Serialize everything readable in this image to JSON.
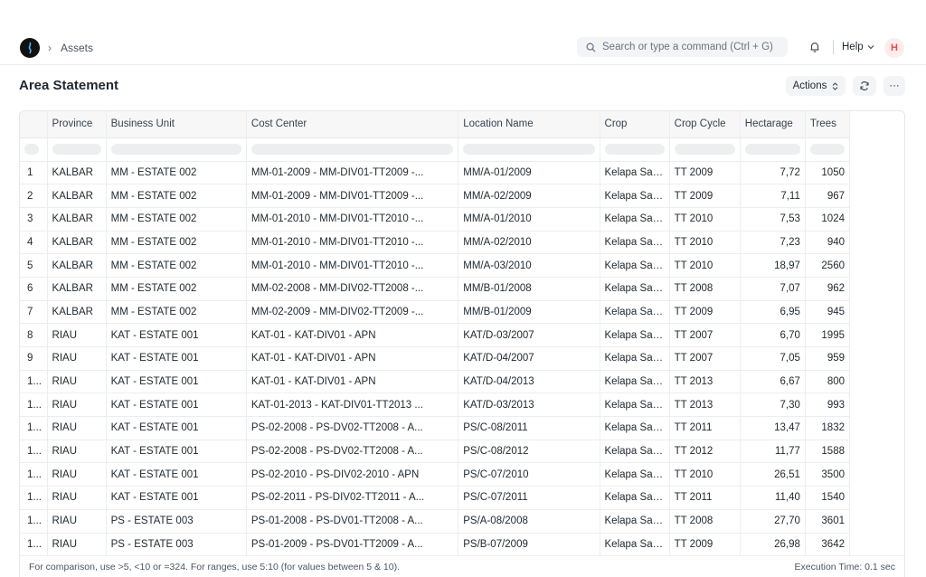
{
  "navbar": {
    "breadcrumb": "Assets",
    "search_placeholder": "Search or type a command (Ctrl + G)",
    "help_label": "Help",
    "avatar_initial": "H"
  },
  "page": {
    "title": "Area Statement",
    "actions_label": "Actions",
    "more_label": "···"
  },
  "table": {
    "columns": [
      "Province",
      "Business Unit",
      "Cost Center",
      "Location Name",
      "Crop",
      "Crop Cycle",
      "Hectarage",
      "Trees"
    ],
    "rows": [
      {
        "idx": "1",
        "province": "KALBAR",
        "bu": "MM - ESTATE 002",
        "cc": "MM-01-2009 - MM-DIV01-TT2009 -...",
        "loc": "MM/A-01/2009",
        "crop": "Kelapa Sawit",
        "cycle": "TT 2009",
        "ha": "7,72",
        "trees": "1050"
      },
      {
        "idx": "2",
        "province": "KALBAR",
        "bu": "MM - ESTATE 002",
        "cc": "MM-01-2009 - MM-DIV01-TT2009 -...",
        "loc": "MM/A-02/2009",
        "crop": "Kelapa Sawit",
        "cycle": "TT 2009",
        "ha": "7,11",
        "trees": "967"
      },
      {
        "idx": "3",
        "province": "KALBAR",
        "bu": "MM - ESTATE 002",
        "cc": "MM-01-2010 - MM-DIV01-TT2010 -...",
        "loc": "MM/A-01/2010",
        "crop": "Kelapa Sawit",
        "cycle": "TT 2010",
        "ha": "7,53",
        "trees": "1024"
      },
      {
        "idx": "4",
        "province": "KALBAR",
        "bu": "MM - ESTATE 002",
        "cc": "MM-01-2010 - MM-DIV01-TT2010 -...",
        "loc": "MM/A-02/2010",
        "crop": "Kelapa Sawit",
        "cycle": "TT 2010",
        "ha": "7,23",
        "trees": "940"
      },
      {
        "idx": "5",
        "province": "KALBAR",
        "bu": "MM - ESTATE 002",
        "cc": "MM-01-2010 - MM-DIV01-TT2010 -...",
        "loc": "MM/A-03/2010",
        "crop": "Kelapa Sawit",
        "cycle": "TT 2010",
        "ha": "18,97",
        "trees": "2560"
      },
      {
        "idx": "6",
        "province": "KALBAR",
        "bu": "MM - ESTATE 002",
        "cc": "MM-02-2008 - MM-DIV02-TT2008 -...",
        "loc": "MM/B-01/2008",
        "crop": "Kelapa Sawit",
        "cycle": "TT 2008",
        "ha": "7,07",
        "trees": "962"
      },
      {
        "idx": "7",
        "province": "KALBAR",
        "bu": "MM - ESTATE 002",
        "cc": "MM-02-2009 - MM-DIV02-TT2009 -...",
        "loc": "MM/B-01/2009",
        "crop": "Kelapa Sawit",
        "cycle": "TT 2009",
        "ha": "6,95",
        "trees": "945"
      },
      {
        "idx": "8",
        "province": "RIAU",
        "bu": "KAT - ESTATE 001",
        "cc": "KAT-01 - KAT-DIV01 - APN",
        "loc": "KAT/D-03/2007",
        "crop": "Kelapa Sawit",
        "cycle": "TT 2007",
        "ha": "6,70",
        "trees": "1995"
      },
      {
        "idx": "9",
        "province": "RIAU",
        "bu": "KAT - ESTATE 001",
        "cc": "KAT-01 - KAT-DIV01 - APN",
        "loc": "KAT/D-04/2007",
        "crop": "Kelapa Sawit",
        "cycle": "TT 2007",
        "ha": "7,05",
        "trees": "959"
      },
      {
        "idx": "1...",
        "province": "RIAU",
        "bu": "KAT - ESTATE 001",
        "cc": "KAT-01 - KAT-DIV01 - APN",
        "loc": "KAT/D-04/2013",
        "crop": "Kelapa Sawit",
        "cycle": "TT 2013",
        "ha": "6,67",
        "trees": "800"
      },
      {
        "idx": "1...",
        "province": "RIAU",
        "bu": "KAT - ESTATE 001",
        "cc": "KAT-01-2013 - KAT-DIV01-TT2013 ...",
        "loc": "KAT/D-03/2013",
        "crop": "Kelapa Sawit",
        "cycle": "TT 2013",
        "ha": "7,30",
        "trees": "993"
      },
      {
        "idx": "1...",
        "province": "RIAU",
        "bu": "KAT - ESTATE 001",
        "cc": "PS-02-2008 - PS-DV02-TT2008 - A...",
        "loc": "PS/C-08/2011",
        "crop": "Kelapa Sawit",
        "cycle": "TT 2011",
        "ha": "13,47",
        "trees": "1832"
      },
      {
        "idx": "1...",
        "province": "RIAU",
        "bu": "KAT - ESTATE 001",
        "cc": "PS-02-2008 - PS-DV02-TT2008 - A...",
        "loc": "PS/C-08/2012",
        "crop": "Kelapa Sawit",
        "cycle": "TT 2012",
        "ha": "11,77",
        "trees": "1588"
      },
      {
        "idx": "1...",
        "province": "RIAU",
        "bu": "KAT - ESTATE 001",
        "cc": "PS-02-2010 - PS-DIV02-2010 - APN",
        "loc": "PS/C-07/2010",
        "crop": "Kelapa Sawit",
        "cycle": "TT 2010",
        "ha": "26,51",
        "trees": "3500"
      },
      {
        "idx": "1...",
        "province": "RIAU",
        "bu": "KAT - ESTATE 001",
        "cc": "PS-02-2011 - PS-DIV02-TT2011 - A...",
        "loc": "PS/C-07/2011",
        "crop": "Kelapa Sawit",
        "cycle": "TT 2011",
        "ha": "11,40",
        "trees": "1540"
      },
      {
        "idx": "1...",
        "province": "RIAU",
        "bu": "PS - ESTATE 003",
        "cc": "PS-01-2008 - PS-DV01-TT2008 - A...",
        "loc": "PS/A-08/2008",
        "crop": "Kelapa Sawit",
        "cycle": "TT 2008",
        "ha": "27,70",
        "trees": "3601"
      },
      {
        "idx": "1...",
        "province": "RIAU",
        "bu": "PS - ESTATE 003",
        "cc": "PS-01-2009 - PS-DV01-TT2009 - A...",
        "loc": "PS/B-07/2009",
        "crop": "Kelapa Sawit",
        "cycle": "TT 2009",
        "ha": "26,98",
        "trees": "3642"
      }
    ]
  },
  "footer": {
    "hint": "For comparison, use >5, <10 or =324. For ranges, use 5:10 (for values between 5 & 10).",
    "execution_time": "Execution Time: 0.1 sec"
  },
  "icons": {
    "logo": "app-logo-icon",
    "search": "search-icon",
    "bell": "bell-icon",
    "chevron": "chevron-down-icon",
    "sort": "sort-icon",
    "refresh": "refresh-icon"
  }
}
